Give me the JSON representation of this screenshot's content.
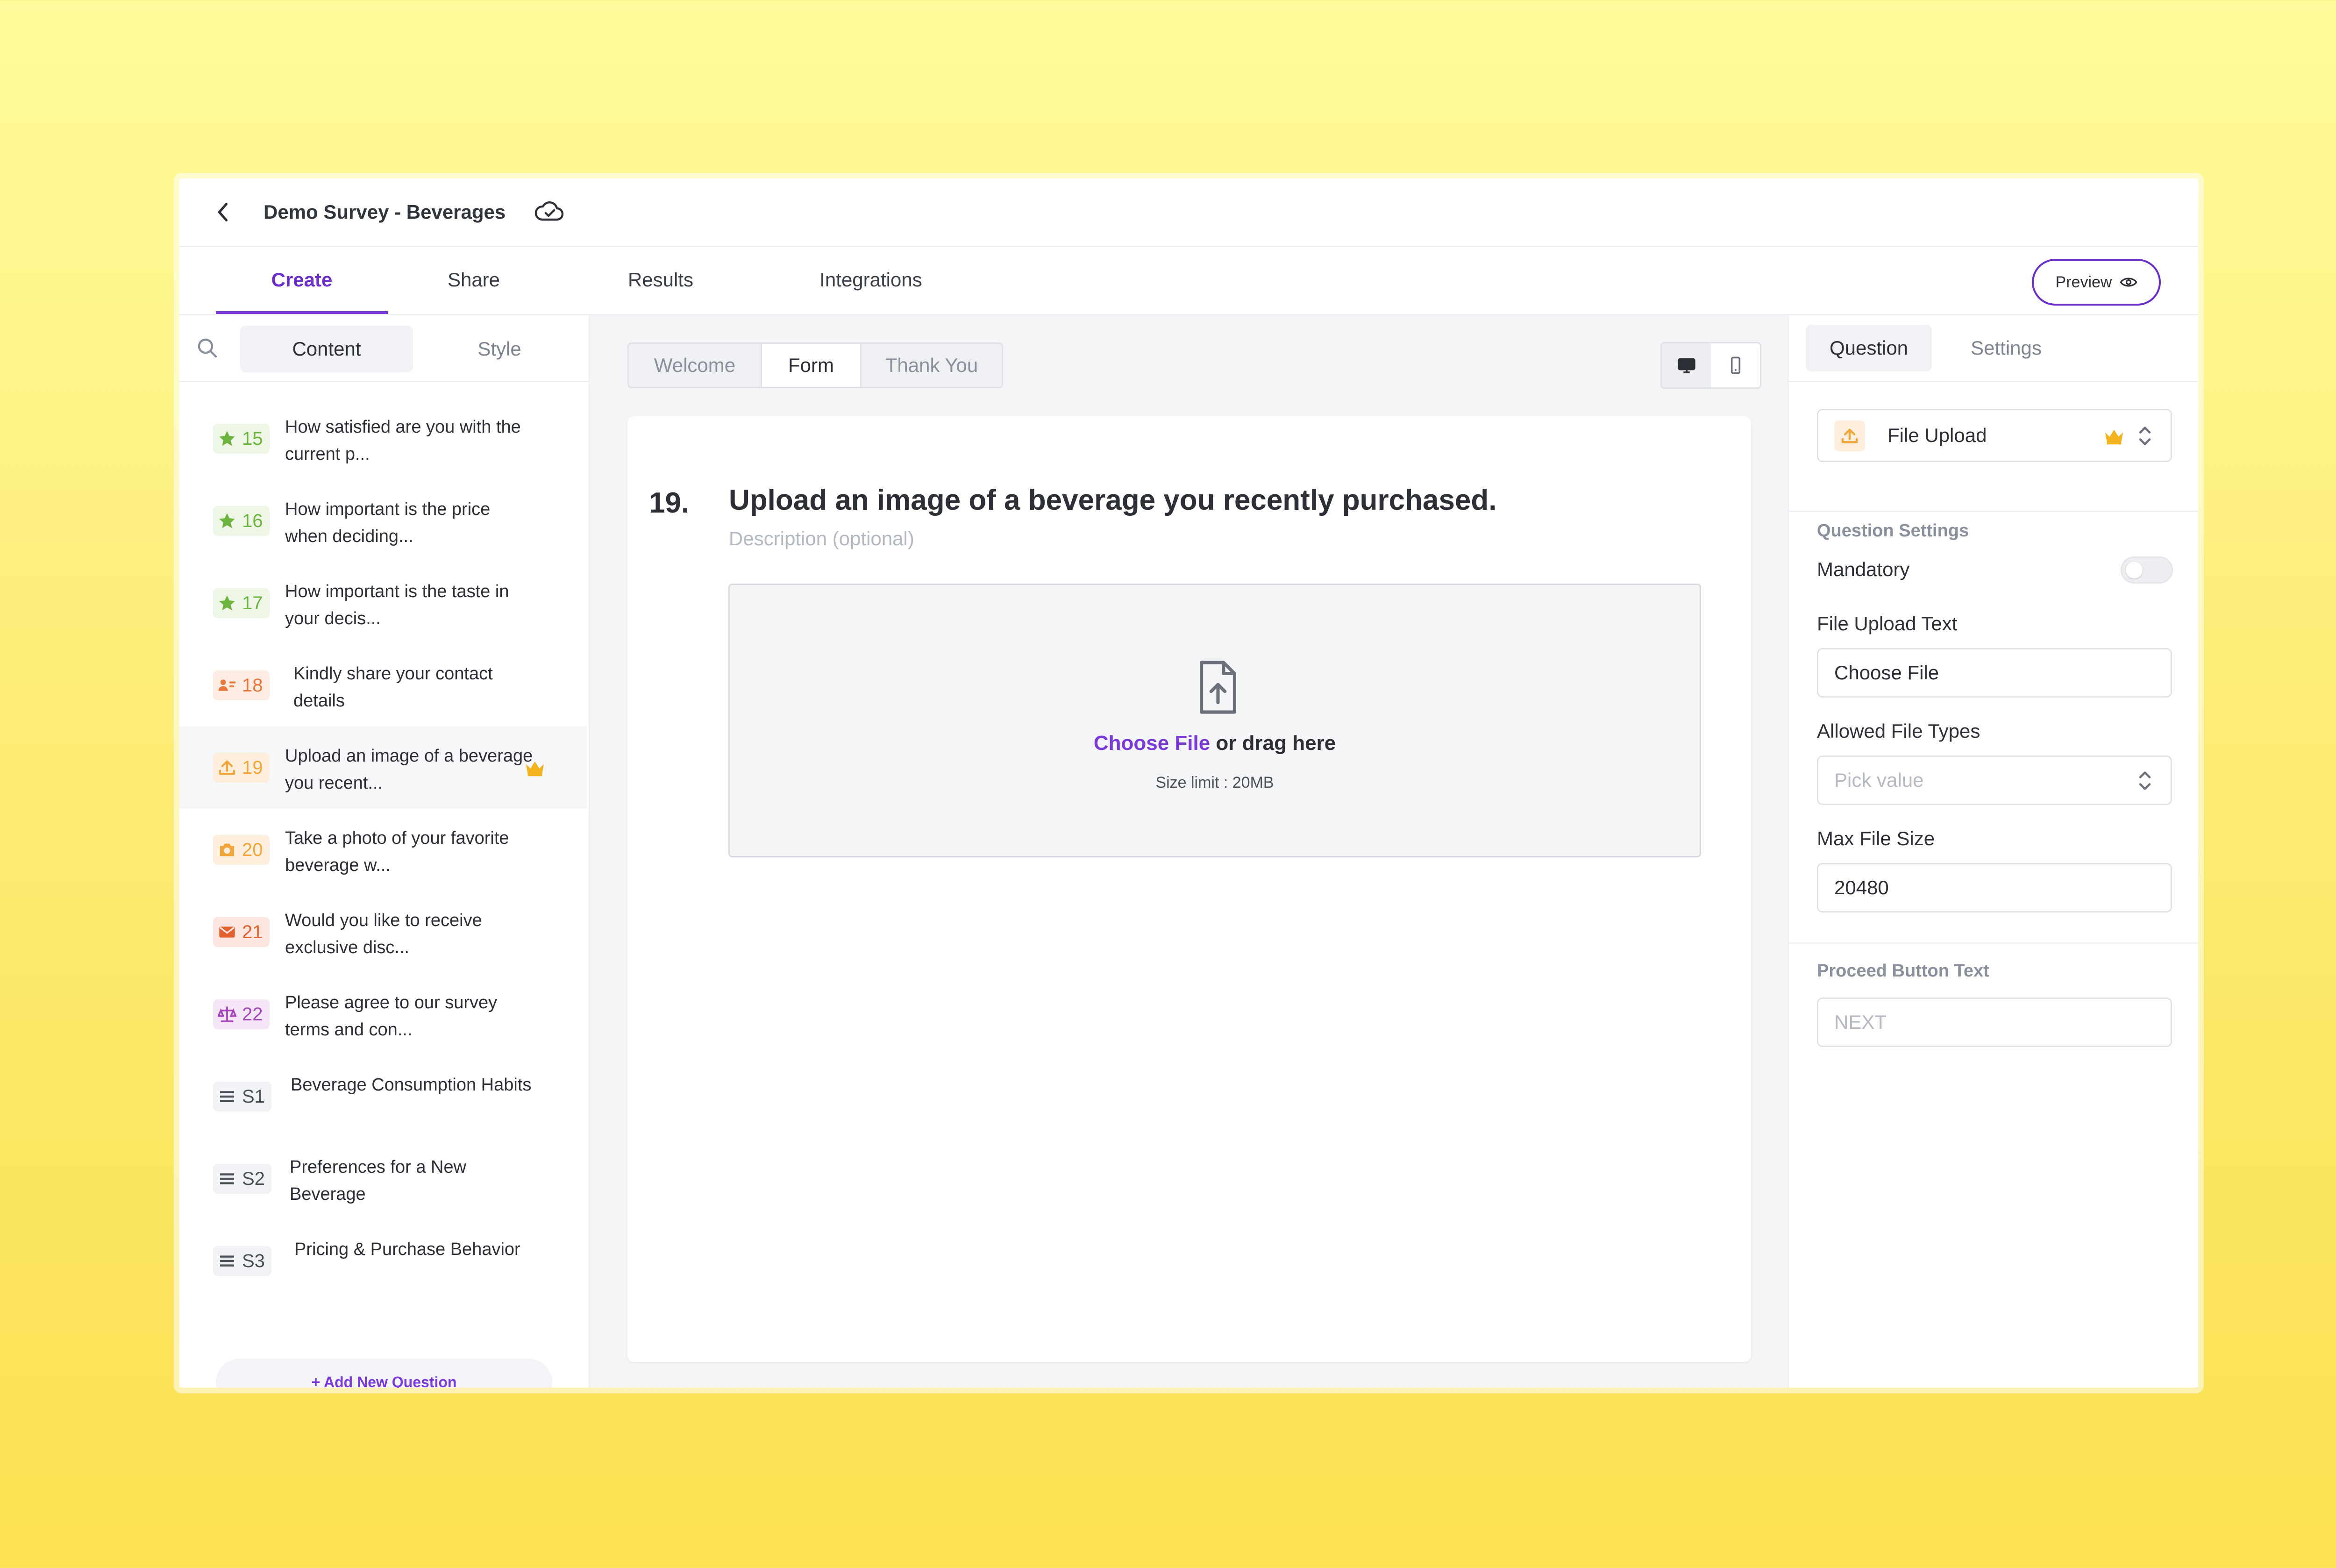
{
  "header": {
    "survey_title": "Demo Survey - Beverages"
  },
  "main_tabs": [
    {
      "label": "Create",
      "active": true
    },
    {
      "label": "Share"
    },
    {
      "label": "Results"
    },
    {
      "label": "Integrations"
    }
  ],
  "preview_label": "Preview",
  "sidebar": {
    "tabs": [
      "Content",
      "Style"
    ],
    "items": [
      {
        "num": "15",
        "icon": "star-icon",
        "text": "How satisfied are you with the current p..."
      },
      {
        "num": "16",
        "icon": "star-icon",
        "text": "How important is the price when deciding..."
      },
      {
        "num": "17",
        "icon": "star-icon",
        "text": "How important is the taste in your decis..."
      },
      {
        "num": "18",
        "icon": "contact-icon",
        "text": "Kindly share your contact details"
      },
      {
        "num": "19",
        "icon": "upload-icon",
        "text": "Upload an image of a beverage you recent...",
        "active": true
      },
      {
        "num": "20",
        "icon": "camera-icon",
        "text": "Take a photo of your favorite beverage w..."
      },
      {
        "num": "21",
        "icon": "mail-icon",
        "text": "Would you like to receive exclusive disc..."
      },
      {
        "num": "22",
        "icon": "scale-icon",
        "text": "Please agree to our survey terms and con..."
      },
      {
        "num": "S1",
        "icon": "section-icon",
        "text": "Beverage Consumption Habits"
      },
      {
        "num": "S2",
        "icon": "section-icon",
        "text": "Preferences for a New Beverage"
      },
      {
        "num": "S3",
        "icon": "section-icon",
        "text": "Pricing & Purchase Behavior"
      }
    ],
    "add_label": "+ Add New Question"
  },
  "center": {
    "segments": [
      "Welcome",
      "Form",
      "Thank You"
    ],
    "active_segment": "Form",
    "question": {
      "number": "19.",
      "title": "Upload an image of a beverage you recently purchased.",
      "description_placeholder": "Description (optional)",
      "choose_file": "Choose File",
      "drag_text": " or drag here",
      "size_limit": "Size limit : 20MB"
    }
  },
  "right_panel": {
    "tabs": [
      "Question",
      "Settings"
    ],
    "type_label": "File Upload",
    "section_question_settings": "Question Settings",
    "mandatory_label": "Mandatory",
    "mandatory_on": false,
    "file_upload_text_label": "File Upload Text",
    "file_upload_text_value": "Choose File",
    "allowed_types_label": "Allowed File Types",
    "allowed_types_placeholder": "Pick value",
    "max_size_label": "Max File Size",
    "max_size_value": "20480",
    "proceed_label": "Proceed Button Text",
    "proceed_placeholder": "NEXT"
  },
  "colors": {
    "accent": "#7a3ad9",
    "star_green": "#6cb33f",
    "orange": "#e8763a",
    "amber": "#f0a63a",
    "crown": "#f2b31f"
  }
}
